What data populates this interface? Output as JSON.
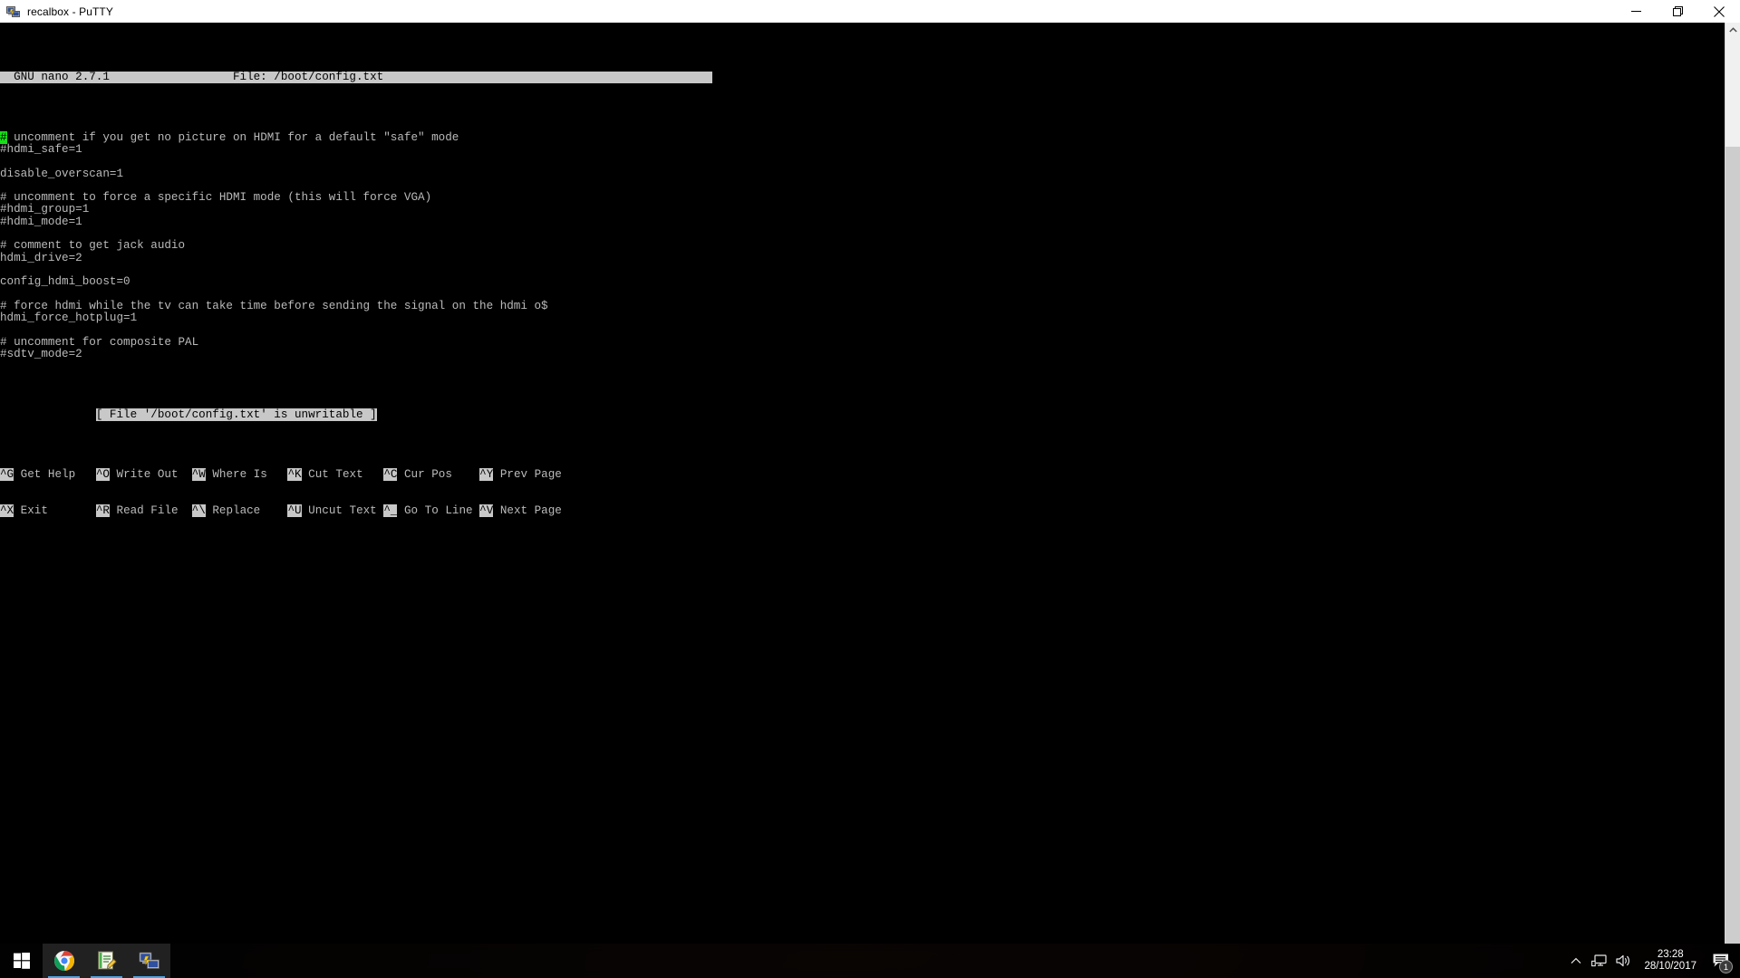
{
  "window": {
    "title": "recalbox - PuTTY",
    "icon": "putty-icon",
    "controls": {
      "minimize": "minimize-icon",
      "maximize": "maximize-icon",
      "close": "close-icon"
    }
  },
  "nano": {
    "header": {
      "version": "  GNU nano 2.7.1",
      "file_label": "File: /boot/config.txt",
      "full": "  GNU nano 2.7.1                  File: /boot/config.txt                                                "
    },
    "cursor_char": "#",
    "lines": [
      " uncomment if you get no picture on HDMI for a default \"safe\" mode",
      "#hdmi_safe=1",
      "",
      "disable_overscan=1",
      "",
      "# uncomment to force a specific HDMI mode (this will force VGA)",
      "#hdmi_group=1",
      "#hdmi_mode=1",
      "",
      "# comment to get jack audio",
      "hdmi_drive=2",
      "",
      "config_hdmi_boost=0",
      "",
      "# force hdmi while the tv can take time before sending the signal on the hdmi o$",
      "hdmi_force_hotplug=1",
      "",
      "# uncomment for composite PAL",
      "#sdtv_mode=2"
    ],
    "status_message": "[ File '/boot/config.txt' is unwritable ]",
    "shortcuts_row1": [
      {
        "key": "^G",
        "label": "Get Help"
      },
      {
        "key": "^O",
        "label": "Write Out"
      },
      {
        "key": "^W",
        "label": "Where Is"
      },
      {
        "key": "^K",
        "label": "Cut Text"
      },
      {
        "key": "^C",
        "label": "Cur Pos"
      },
      {
        "key": "^Y",
        "label": "Prev Page"
      }
    ],
    "shortcuts_row2": [
      {
        "key": "^X",
        "label": "Exit"
      },
      {
        "key": "^R",
        "label": "Read File"
      },
      {
        "key": "^\\",
        "label": "Replace"
      },
      {
        "key": "^U",
        "label": "Uncut Text"
      },
      {
        "key": "^_",
        "label": "Go To Line"
      },
      {
        "key": "^V",
        "label": "Next Page"
      }
    ]
  },
  "scrollbar": {
    "up_arrow": "chevron-up-icon"
  },
  "taskbar": {
    "start": "windows-start-icon",
    "items": [
      {
        "name": "chrome-icon",
        "active": true
      },
      {
        "name": "notepadpp-icon",
        "active": true
      },
      {
        "name": "putty-icon",
        "active": true
      }
    ],
    "tray": {
      "show_hidden": "chevron-up-icon",
      "network": "network-icon",
      "volume": "volume-icon",
      "time": "23:28",
      "date": "28/10/2017",
      "notifications_icon": "action-center-icon",
      "notifications_count": "1"
    }
  },
  "colors": {
    "terminal_bg": "#000000",
    "terminal_fg": "#bbbbbb",
    "inverse_bg": "#c8c8c8",
    "cursor_green": "#18e018",
    "taskbar_accent": "#4ba3e3"
  }
}
